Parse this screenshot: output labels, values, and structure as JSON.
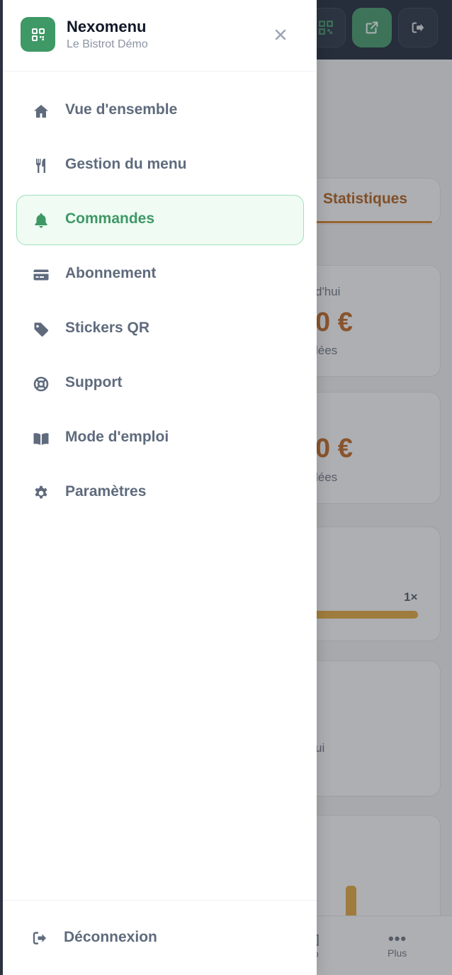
{
  "brand": {
    "name": "Nexomenu",
    "subtitle": "Le Bistrot Démo",
    "accent_color": "#3f9966"
  },
  "nav": {
    "items": [
      {
        "label": "Vue d'ensemble",
        "icon": "home-icon",
        "active": false
      },
      {
        "label": "Gestion du menu",
        "icon": "fork-knife-icon",
        "active": false
      },
      {
        "label": "Commandes",
        "icon": "bell-icon",
        "active": true
      },
      {
        "label": "Abonnement",
        "icon": "credit-card-icon",
        "active": false
      },
      {
        "label": "Stickers QR",
        "icon": "tag-icon",
        "active": false
      },
      {
        "label": "Support",
        "icon": "lifebuoy-icon",
        "active": false
      },
      {
        "label": "Mode d'emploi",
        "icon": "book-icon",
        "active": false
      },
      {
        "label": "Paramètres",
        "icon": "gear-icon",
        "active": false
      }
    ],
    "logout_label": "Déconnexion"
  },
  "background": {
    "tab_label": "Statistiques",
    "card1": {
      "label": "d'hui",
      "value": "0 €",
      "sub": "lées"
    },
    "card2": {
      "value": "0 €",
      "sub": "lées"
    },
    "card3": {
      "count": "1×"
    },
    "card4": {
      "text": "ui"
    },
    "bottom_nav": {
      "more_label": "Plus",
      "more_icon": "•••",
      "partial_label": "o"
    }
  }
}
